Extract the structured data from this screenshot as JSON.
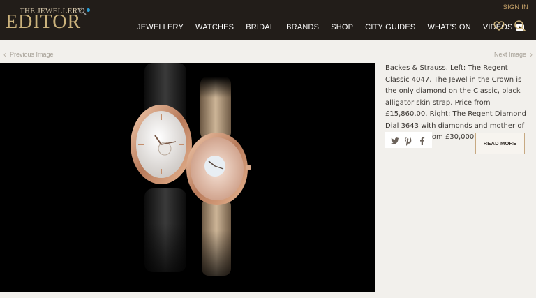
{
  "logo": {
    "small": "THE JEWELLERY",
    "big": "EDITOR"
  },
  "header": {
    "signin": "SIGN IN",
    "nav": [
      {
        "label": "JEWELLERY"
      },
      {
        "label": "WATCHES"
      },
      {
        "label": "BRIDAL"
      },
      {
        "label": "BRANDS"
      },
      {
        "label": "SHOP"
      },
      {
        "label": "CITY GUIDES"
      },
      {
        "label": "WHAT'S ON"
      },
      {
        "label": "VIDEOS"
      }
    ],
    "icons": [
      "heart-icon",
      "search-icon"
    ]
  },
  "pager": {
    "prev": "Previous Image",
    "next": "Next Image"
  },
  "caption": "Backes & Strauss. Left: The Regent Classic 4047, The Jewel in the Crown is the only diamond on the Classic, black alligator skin strap. Price from £15,860.00. Right: The Regent Diamond Dial 3643 with diamonds and mother of pearl. Price from £30,000.00.",
  "share": [
    "twitter-icon",
    "pinterest-icon",
    "facebook-icon"
  ],
  "read_more": "READ MORE",
  "colors": {
    "header_bg": "#221d19",
    "gold": "#cbb27c",
    "logo_dot": "#2a9fd6",
    "page_bg": "#f2f0ec",
    "button_border": "#c7a982"
  }
}
